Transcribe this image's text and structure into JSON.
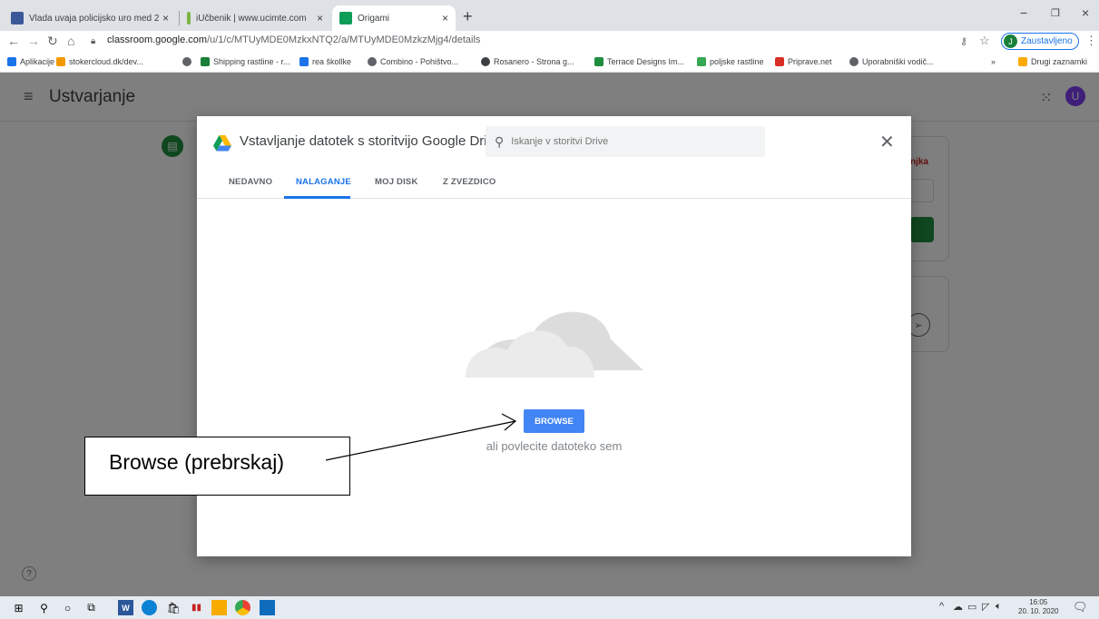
{
  "browser": {
    "tabs": [
      {
        "title": "Vlada uvaja policijsko uro med 2",
        "icon_color": "#3b5998"
      },
      {
        "title": "iUčbenik | www.ucimte.com",
        "icon_color": "#7cb342"
      },
      {
        "title": "Origami",
        "icon_color": "#0f9d58"
      }
    ],
    "tab_close": "×",
    "new_tab": "+",
    "url_domain": "classroom.google.com",
    "url_path": "/u/1/c/MTUyMDE0MzkxNTQ2/a/MTUyMDE0MzkzMjg4/details",
    "profile_initial": "J",
    "profile_label": "Zaustavljeno",
    "window_controls": [
      "−",
      "❐",
      "×"
    ]
  },
  "bookmarks": [
    {
      "label": "Aplikacije",
      "color": "#1a73e8"
    },
    {
      "label": "stokercloud.dk/dev...",
      "color": "#f29900"
    },
    {
      "label": "",
      "color": "#5f6368"
    },
    {
      "label": "Shipping rastline - r...",
      "color": "#188038"
    },
    {
      "label": "rea škollke",
      "color": "#1a73e8"
    },
    {
      "label": "Combino - Pohištvo...",
      "color": "#5f6368"
    },
    {
      "label": "Rosanero - Strona g...",
      "color": "#3c4043"
    },
    {
      "label": "Terrace Designs Im...",
      "color": "#1e8e3e"
    },
    {
      "label": "poljske rastline",
      "color": "#34a853"
    },
    {
      "label": "Priprave.net",
      "color": "#d93025"
    },
    {
      "label": "Uporabniški vodič...",
      "color": "#5f6368"
    }
  ],
  "bookmarks_more": "»",
  "bookmarks_other": "Drugi zaznamki",
  "classroom": {
    "title": "Ustvarjanje",
    "user_initial": "U",
    "side_label": "njka"
  },
  "picker": {
    "title": "Vstavljanje datotek s storitvijo Google Drive",
    "search_placeholder": "Iskanje v storitvi Drive",
    "tabs": [
      "NEDAVNO",
      "NALAGANJE",
      "MOJ DISK",
      "Z ZVEZDICO"
    ],
    "active_tab": "NALAGANJE",
    "browse_label": "BROWSE",
    "drag_text": "ali povlecite datoteko sem"
  },
  "annotation": {
    "text": "Browse (prebrskaj)"
  },
  "taskbar": {
    "time": "16:05",
    "date": "20. 10. 2020"
  },
  "colors": {
    "accent": "#1a73e8",
    "browse_button": "#4285f4",
    "classroom_green": "#1e8e3e"
  }
}
